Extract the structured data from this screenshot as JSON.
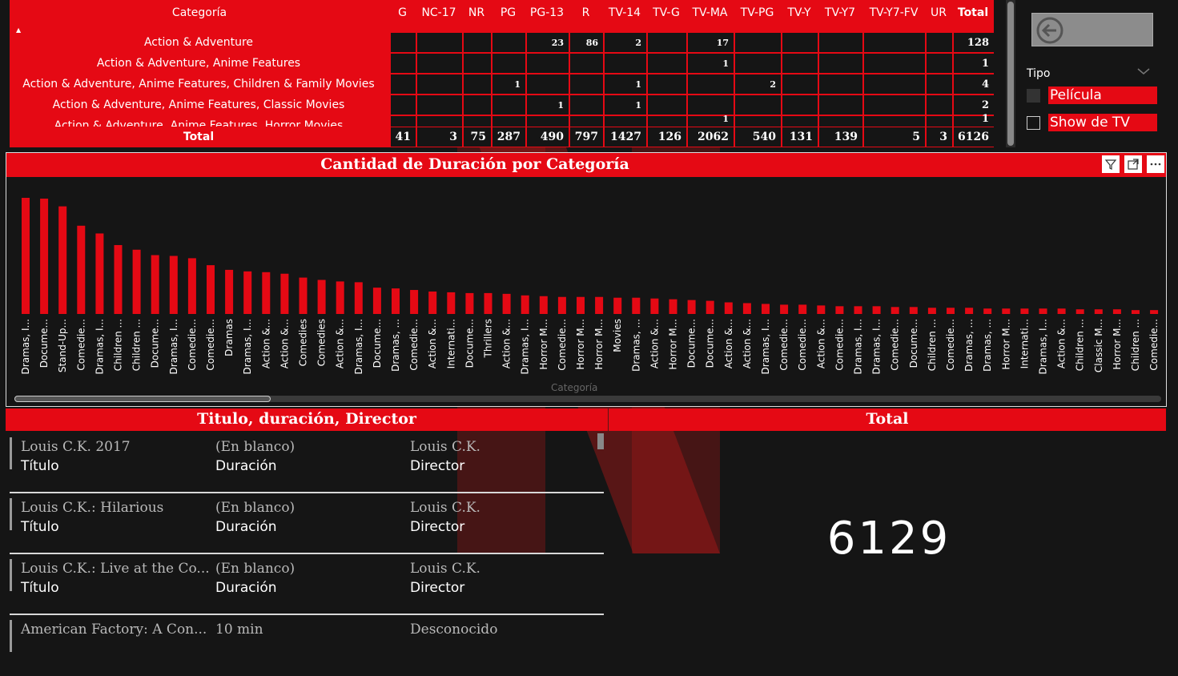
{
  "matrix": {
    "header_label": "Categoría",
    "columns": [
      "G",
      "NC-17",
      "NR",
      "PG",
      "PG-13",
      "R",
      "TV-14",
      "TV-G",
      "TV-MA",
      "TV-PG",
      "TV-Y",
      "TV-Y7",
      "TV-Y7-FV",
      "UR",
      "Total"
    ],
    "rows": [
      {
        "name": "Action & Adventure",
        "values": [
          "",
          "",
          "",
          "",
          "23",
          "86",
          "2",
          "",
          "17",
          "",
          "",
          "",
          "",
          "",
          "128"
        ]
      },
      {
        "name": "Action & Adventure, Anime Features",
        "values": [
          "",
          "",
          "",
          "",
          "",
          "",
          "",
          "",
          "1",
          "",
          "",
          "",
          "",
          "",
          "1"
        ]
      },
      {
        "name": "Action & Adventure, Anime Features, Children & Family Movies",
        "values": [
          "",
          "",
          "",
          "1",
          "",
          "",
          "1",
          "",
          "",
          "2",
          "",
          "",
          "",
          "",
          "4"
        ]
      },
      {
        "name": "Action & Adventure, Anime Features, Classic Movies",
        "values": [
          "",
          "",
          "",
          "",
          "1",
          "",
          "1",
          "",
          "",
          "",
          "",
          "",
          "",
          "",
          "2"
        ]
      },
      {
        "name": "Action & Adventure, Anime Features, Horror Movies",
        "values": [
          "",
          "",
          "",
          "",
          "",
          "",
          "",
          "",
          "1",
          "",
          "",
          "",
          "",
          "",
          "1"
        ]
      }
    ],
    "total_label": "Total",
    "totals": [
      "41",
      "3",
      "75",
      "287",
      "490",
      "797",
      "1427",
      "126",
      "2062",
      "540",
      "131",
      "139",
      "5",
      "3",
      "6126"
    ]
  },
  "slicer": {
    "title": "Tipo",
    "items": [
      {
        "label": "Película",
        "checked": true
      },
      {
        "label": "Show de TV",
        "checked": false
      }
    ]
  },
  "chart_data": {
    "type": "bar",
    "title": "Cantidad de Duración por Categoría",
    "xlabel": "Categoría",
    "ylabel": "",
    "ylim": [
      0,
      150
    ],
    "color": "#e50914",
    "categories": [
      "Dramas, I...",
      "Docume...",
      "Stand-Up...",
      "Comedie...",
      "Dramas, I...",
      "Children ...",
      "Children ...",
      "Docume...",
      "Dramas, I...",
      "Comedie...",
      "Comedie...",
      "Dramas",
      "Dramas, I...",
      "Action &...",
      "Action &...",
      "Comedies",
      "Comedies",
      "Action &...",
      "Dramas, I...",
      "Docume...",
      "Dramas, ...",
      "Comedie...",
      "Action &...",
      "Internati...",
      "Docume...",
      "Thrillers",
      "Action &...",
      "Dramas, I...",
      "Horror M...",
      "Comedie...",
      "Horror M...",
      "Horror M...",
      "Movies",
      "Dramas, ...",
      "Action &...",
      "Horror M...",
      "Docume...",
      "Docume...",
      "Action &...",
      "Action &...",
      "Dramas, I...",
      "Comedie...",
      "Comedie...",
      "Action &...",
      "Comedie...",
      "Dramas, I...",
      "Dramas, I...",
      "Comedie...",
      "Docume...",
      "Children ...",
      "Comedie...",
      "Dramas, ...",
      "Dramas, ...",
      "Horror M...",
      "Internati...",
      "Dramas, I...",
      "Action &...",
      "Children ...",
      "Classic M...",
      "Horror M...",
      "Children ...",
      "Comedie..."
    ],
    "values": [
      150,
      149,
      139,
      114,
      104,
      89,
      83,
      76,
      75,
      72,
      63,
      57,
      55,
      54,
      52,
      47,
      44,
      42,
      41,
      34,
      33,
      31,
      29,
      28,
      27,
      27,
      26,
      24,
      23,
      22,
      22,
      22,
      21,
      21,
      20,
      19,
      18,
      17,
      15,
      14,
      13,
      12,
      12,
      11,
      10,
      10,
      10,
      9,
      9,
      8,
      8,
      8,
      7,
      7,
      7,
      7,
      7,
      6,
      6,
      6,
      5,
      5
    ]
  },
  "toolbar": {
    "filter_icon": "filter-icon",
    "focus_icon": "focus-mode-icon",
    "more_icon": "more-options-icon"
  },
  "details": {
    "title": "Titulo, duración, Director",
    "labels": {
      "title": "Título",
      "duration": "Duración",
      "director": "Director"
    },
    "items": [
      {
        "title": "Louis C.K. 2017",
        "duration": "(En blanco)",
        "director": "Louis C.K."
      },
      {
        "title": "Louis C.K.: Hilarious",
        "duration": "(En blanco)",
        "director": "Louis C.K."
      },
      {
        "title": "Louis C.K.: Live at the Co...",
        "duration": "(En blanco)",
        "director": "Louis C.K."
      },
      {
        "title": "American Factory: A Con...",
        "duration": "10 min",
        "director": "Desconocido"
      }
    ]
  },
  "card": {
    "title": "Total",
    "value": "6129"
  }
}
